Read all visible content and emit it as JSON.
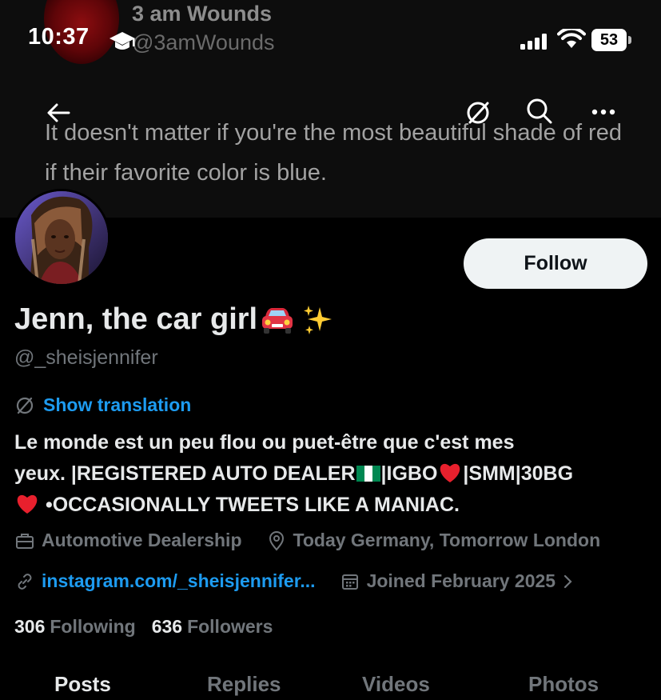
{
  "status_bar": {
    "time": "10:37",
    "battery": "53"
  },
  "banner": {
    "name": "3 am Wounds",
    "handle": "@3amWounds",
    "quote": "It doesn't matter if you're the most beautiful shade of red if their favorite color is blue."
  },
  "nav": {
    "back_icon": "back-arrow-icon",
    "translate_icon": "translate-icon",
    "search_icon": "search-icon",
    "more_icon": "more-icon"
  },
  "profile": {
    "follow_label": "Follow",
    "display_name": "Jenn, the car girl",
    "display_name_emojis": [
      "🚘",
      "✨"
    ],
    "handle": "@_sheisjennifer",
    "show_translation": "Show translation",
    "bio_lines": [
      {
        "a": "Le monde est un peu flou ou puet-être que c'est mes"
      },
      {
        "a": "yeux. |REGISTERED AUTO DEALER",
        "b": "|IGBO",
        "c": "|SMM|30BG"
      },
      {
        "a": "•OCCASIONALLY TWEETS LIKE A MANIAC."
      }
    ],
    "bio_emojis": [
      "🇳🇬",
      "❤️",
      "❤️"
    ],
    "category": "Automotive Dealership",
    "location": "Today Germany, Tomorrow London",
    "link": "instagram.com/_sheisjennifer...",
    "joined": "Joined February 2025",
    "following_count": "306",
    "following_label": "Following",
    "followers_count": "636",
    "followers_label": "Followers"
  },
  "tabs": [
    {
      "label": "Posts",
      "active": true
    },
    {
      "label": "Replies",
      "active": false
    },
    {
      "label": "Videos",
      "active": false
    },
    {
      "label": "Photos",
      "active": false
    }
  ],
  "colors": {
    "background": "#000000",
    "text": "#e7e9ea",
    "muted": "#71767b",
    "link": "#1d9bf0",
    "follow_bg": "#eff3f4"
  }
}
